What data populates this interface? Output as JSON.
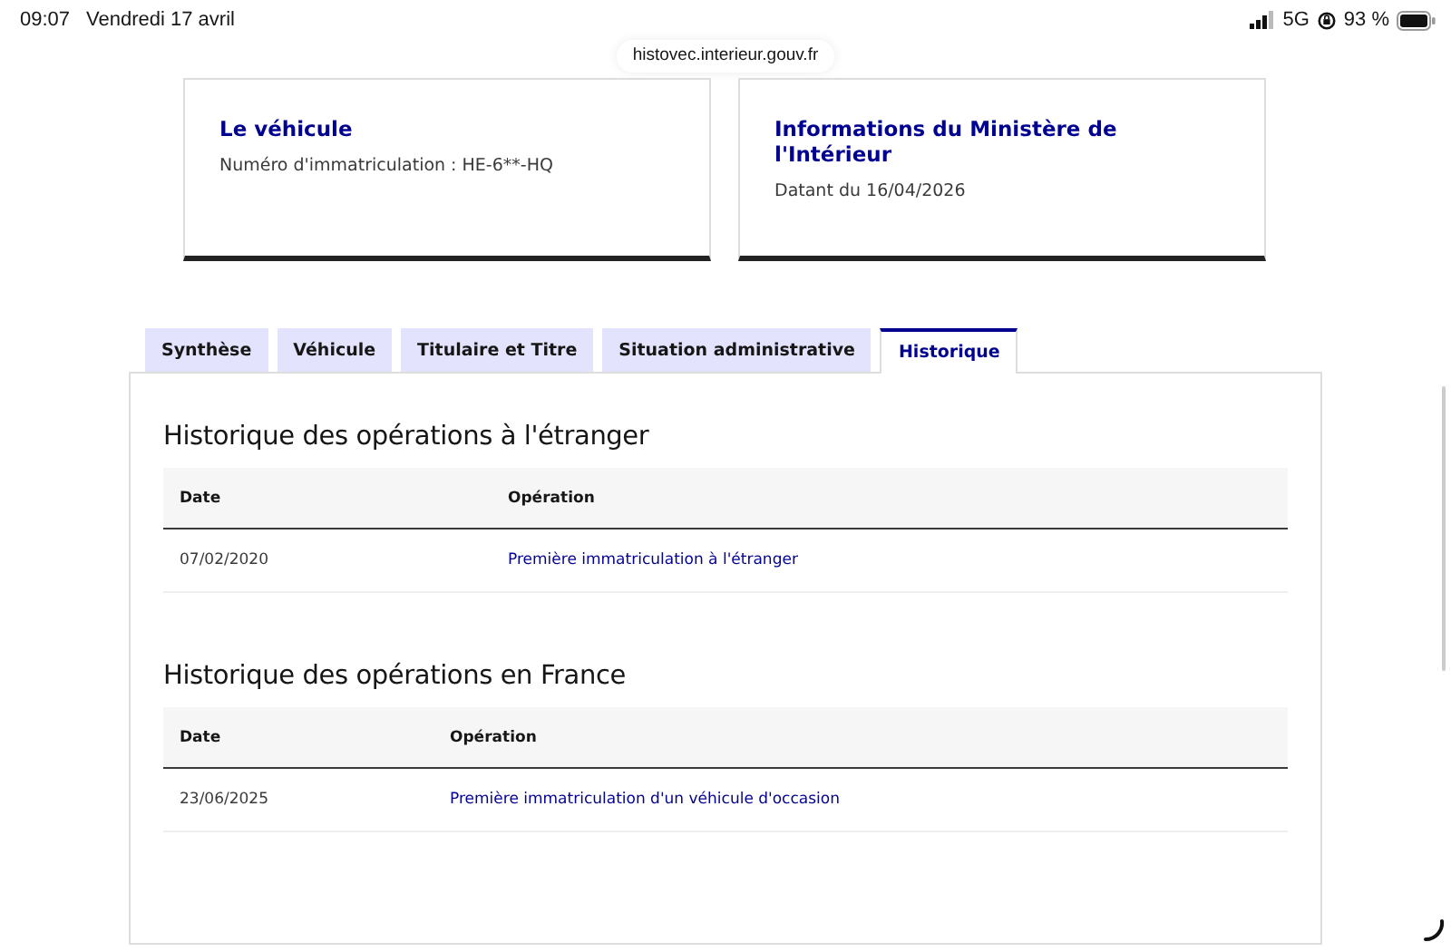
{
  "status_bar": {
    "time": "09:07",
    "date": "Vendredi 17 avril",
    "network": "5G",
    "battery": "93 %"
  },
  "address_bar": {
    "url": "histovec.interieur.gouv.fr"
  },
  "cards": [
    {
      "title": "Le véhicule",
      "text": "Numéro d'immatriculation : HE-6**-HQ"
    },
    {
      "title": "Informations du Ministère de l'Intérieur",
      "text": "Datant du 16/04/2026"
    }
  ],
  "tabs": [
    {
      "label": "Synthèse",
      "selected": false
    },
    {
      "label": "Véhicule",
      "selected": false
    },
    {
      "label": "Titulaire et Titre",
      "selected": false
    },
    {
      "label": "Situation administrative",
      "selected": false
    },
    {
      "label": "Historique",
      "selected": true
    }
  ],
  "sections": [
    {
      "title": "Historique des opérations à l'étranger",
      "columns": [
        "Date",
        "Opération"
      ],
      "rows": [
        {
          "date": "07/02/2020",
          "operation": "Première immatriculation à l'étranger"
        }
      ]
    },
    {
      "title": "Historique des opérations en France",
      "columns": [
        "Date",
        "Opération"
      ],
      "rows": [
        {
          "date": "23/06/2025",
          "operation": "Première immatriculation d'un véhicule d'occasion"
        }
      ]
    }
  ]
}
